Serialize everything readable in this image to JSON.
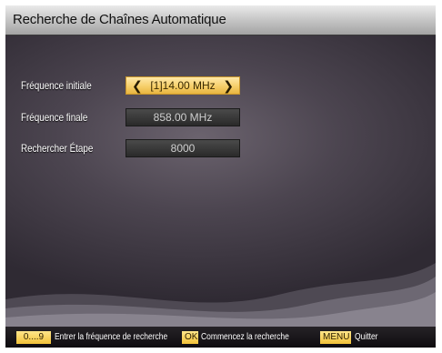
{
  "window": {
    "title": "Recherche de Chaînes Automatique"
  },
  "settings": [
    {
      "label": "Fréquence initiale",
      "value": "[1]14.00 MHz",
      "active": true
    },
    {
      "label": "Fréquence finale",
      "value": "858.00 MHz",
      "active": false
    },
    {
      "label": "Rechercher Étape",
      "value": "8000",
      "active": false
    }
  ],
  "footer": {
    "digits_key": "0....9",
    "digits_hint": "Entrer la fréquence de recherche",
    "ok_key": "OK",
    "ok_hint": "Commencez la recherche",
    "menu_key": "MENU",
    "menu_hint": "Quitter"
  },
  "icons": {
    "left": "chevron-left-icon",
    "right": "chevron-right-icon"
  },
  "colors": {
    "highlight": "#f6cf6a",
    "key": "#f2c239",
    "background": "#4c4550"
  }
}
